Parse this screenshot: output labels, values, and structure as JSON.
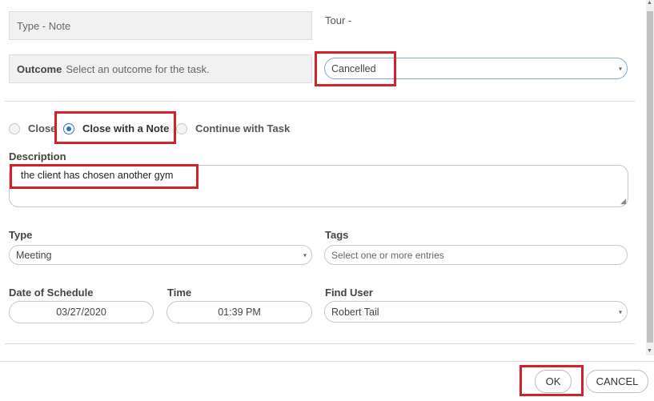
{
  "task": {
    "type_text": "Type - Note",
    "tour_text": "Tour -",
    "outcome_label": "Outcome",
    "outcome_hint": "Select an outcome for the task.",
    "outcome_value": "Cancelled"
  },
  "close_options": {
    "close": "Close",
    "close_with_note": "Close with a Note",
    "continue_with_task": "Continue with Task"
  },
  "description": {
    "label": "Description",
    "value": "the client has chosen another gym"
  },
  "form": {
    "type_label": "Type",
    "type_value": "Meeting",
    "tags_label": "Tags",
    "tags_placeholder": "Select one or more entries",
    "date_label": "Date of Schedule",
    "date_value": "03/27/2020",
    "time_label": "Time",
    "time_value": "01:39 PM",
    "find_user_label": "Find User",
    "find_user_value": "Robert Tail"
  },
  "footer": {
    "ok_label": "OK",
    "cancel_label": "CANCEL"
  },
  "icons": {
    "caret": "▾",
    "scroll_up": "▲",
    "scroll_down": "▼"
  },
  "colors": {
    "highlight": "#d3212b",
    "radio_selected": "#2e6fc4"
  }
}
